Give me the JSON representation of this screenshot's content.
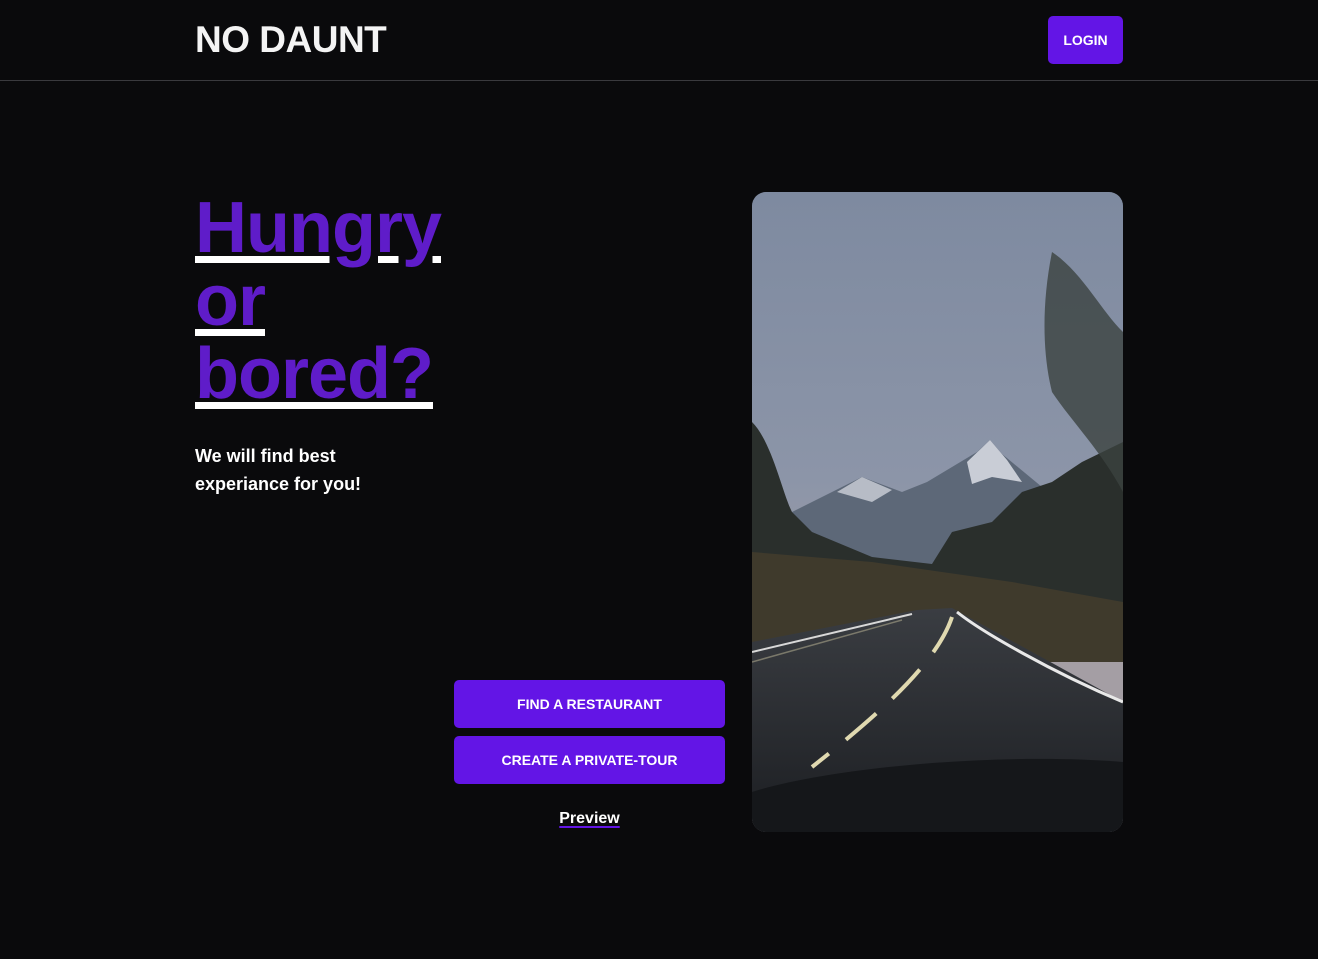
{
  "header": {
    "logo": "NO DAUNT",
    "login_label": "LOGIN"
  },
  "hero": {
    "title_lines": [
      "Hungry",
      "or",
      "bored?"
    ],
    "subtitle": "We will find best experiance for you!"
  },
  "actions": {
    "find_restaurant_label": "FIND A RESTAURANT",
    "private_tour_label": "CREATE A PRIVATE-TOUR",
    "preview_label": "Preview"
  },
  "colors": {
    "background": "#0a0a0c",
    "accent": "#6315e6",
    "title": "#5f1cc9",
    "text": "#ffffff"
  }
}
